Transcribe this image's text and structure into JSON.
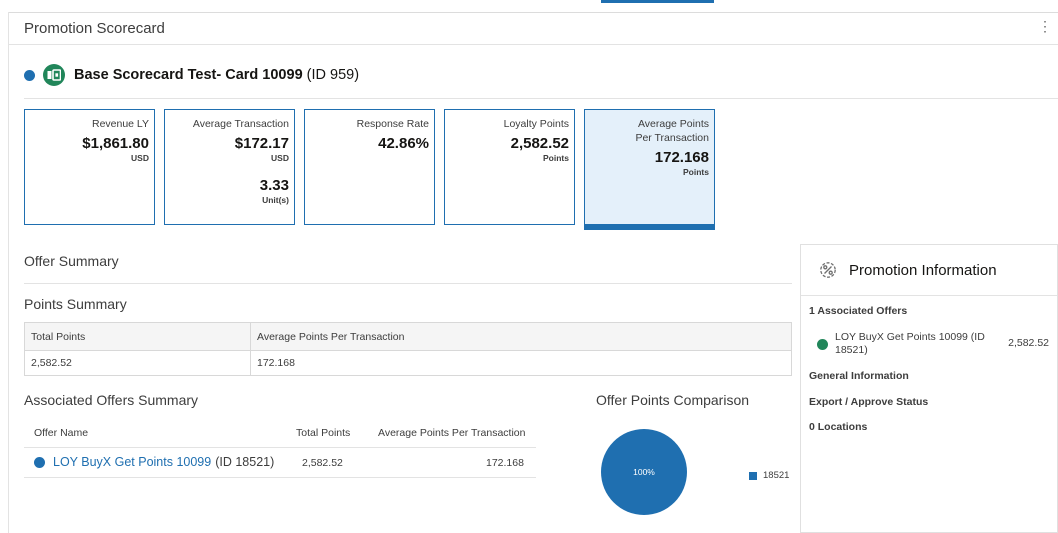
{
  "page": {
    "title": "Promotion Scorecard"
  },
  "scorecard": {
    "name": "Base Scorecard Test- Card 10099",
    "id": "(ID 959)"
  },
  "kpis": [
    {
      "label": "Revenue LY",
      "value": "$1,861.80",
      "unit": "USD"
    },
    {
      "label": "Average Transaction",
      "value": "$172.17",
      "unit": "USD",
      "value2": "3.33",
      "unit2": "Unit(s)"
    },
    {
      "label": "Response Rate",
      "value": "42.86%"
    },
    {
      "label": "Loyalty Points",
      "value": "2,582.52",
      "unit": "Points"
    },
    {
      "label": "Average Points Per Transaction",
      "value": "172.168",
      "unit": "Points",
      "selected": true
    }
  ],
  "offer_summary": {
    "title": "Offer Summary"
  },
  "points_summary": {
    "title": "Points Summary",
    "columns": [
      "Total Points",
      "Average Points Per Transaction"
    ],
    "row": [
      "2,582.52",
      "172.168"
    ]
  },
  "associated_offers": {
    "title": "Associated Offers Summary",
    "columns": [
      "Offer Name",
      "Total Points",
      "Average Points Per Transaction"
    ],
    "rows": [
      {
        "name": "LOY BuyX Get Points 10099",
        "id": "(ID 18521)",
        "total_points": "2,582.52",
        "avg_points": "172.168"
      }
    ]
  },
  "chart_data": {
    "type": "pie",
    "title": "Offer Points Comparison",
    "categories": [
      "18521"
    ],
    "values": [
      100
    ],
    "data_labels": [
      "100%"
    ],
    "legend": "right",
    "colors": [
      "#1f6fb0"
    ]
  },
  "promotion_info": {
    "title": "Promotion Information",
    "icon": "percent-gear-icon",
    "associated_offers_label": "1 Associated Offers",
    "offer": {
      "name": "LOY BuyX Get Points 10099 (ID 18521)",
      "value": "2,582.52"
    },
    "general_info_label": "General Information",
    "export_label": "Export / Approve Status",
    "locations_label": "0 Locations"
  },
  "colors": {
    "accent": "#1f6fb0",
    "success": "#21865a",
    "selected_bg": "#e4f0fa"
  }
}
